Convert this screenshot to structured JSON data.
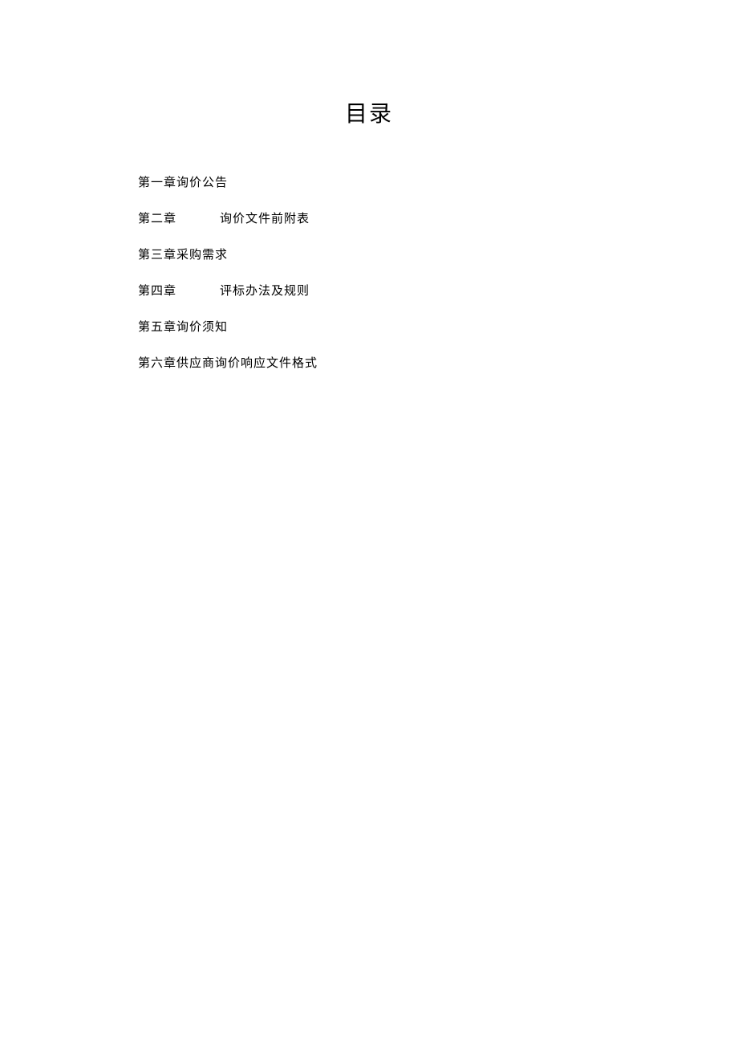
{
  "title": "目录",
  "toc": {
    "items": [
      {
        "chapter": "第一章",
        "title": "询价公告",
        "hasGap": false
      },
      {
        "chapter": "第二章",
        "title": "询价文件前附表",
        "hasGap": true
      },
      {
        "chapter": "第三章",
        "title": "采购需求",
        "hasGap": false
      },
      {
        "chapter": "第四章",
        "title": "评标办法及规则",
        "hasGap": true
      },
      {
        "chapter": "第五章",
        "title": "询价须知",
        "hasGap": false
      },
      {
        "chapter": "第六章",
        "title": "供应商询价响应文件格式",
        "hasGap": false
      }
    ]
  }
}
